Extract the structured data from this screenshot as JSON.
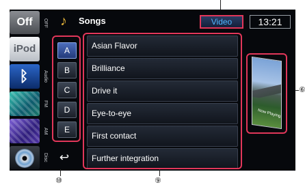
{
  "sources": {
    "off_label": "Off",
    "ipod_label": "iPod",
    "side_labels": [
      "OFF",
      "Audio",
      "FM",
      "AM",
      "Disc"
    ]
  },
  "header": {
    "title": "Songs",
    "video_tab": "Video",
    "clock": "13:21"
  },
  "alphabet": [
    "A",
    "B",
    "C",
    "D",
    "E"
  ],
  "songs": [
    "Asian Flavor",
    "Brilliance",
    "Drive it",
    "Eye-to-eye",
    "First contact",
    "Further integration"
  ],
  "artwork": {
    "now_playing": "Now Playing"
  },
  "callouts": {
    "alpha": "⑩",
    "list": "⑨",
    "art": "⑥"
  },
  "colors": {
    "highlight": "#e2375a",
    "video_text": "#4fb6ff",
    "note_icon": "#e7b53a"
  },
  "icons": {
    "note": "music-note-icon",
    "bluetooth": "bluetooth-icon",
    "back": "return-arrow-icon",
    "disc": "disc-icon"
  }
}
